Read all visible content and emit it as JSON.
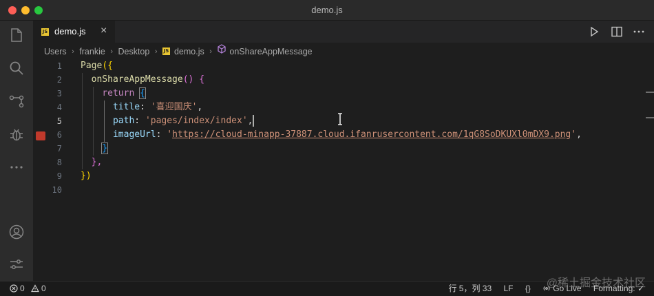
{
  "window": {
    "title": "demo.js"
  },
  "tab": {
    "badge": "JS",
    "label": "demo.js",
    "close": "×"
  },
  "breadcrumb": {
    "items": [
      "Users",
      "frankie",
      "Desktop",
      "demo.js",
      "onShareAppMessage"
    ],
    "separator": "›"
  },
  "editor": {
    "line_numbers": [
      "1",
      "2",
      "3",
      "4",
      "5",
      "6",
      "7",
      "8",
      "9",
      "10"
    ],
    "active_line": "5",
    "code": {
      "l1_fn": "Page",
      "l1_open": "({",
      "l2_fn": "onShareAppMessage",
      "l2_rest": "() {",
      "l3_kw": "return",
      "l3_brace": "{",
      "l4_prop": "title",
      "l4_colon": ": ",
      "l4_str": "'喜迎国庆'",
      "l4_comma": ",",
      "l5_prop": "path",
      "l5_colon": ": ",
      "l5_str": "'pages/index/index'",
      "l5_comma": ",",
      "l6_prop": "imageUrl",
      "l6_colon": ": ",
      "l6_q1": "'",
      "l6_url": "https://cloud-minapp-37887.cloud.ifanrusercontent.com/1qG8SoDKUXl0mDX9.png",
      "l6_q2": "'",
      "l6_comma": ",",
      "l7_brace": "}",
      "l8_close": "},",
      "l9_close": "})"
    }
  },
  "statusbar": {
    "errors": "0",
    "warnings": "0",
    "cursor_position": "行 5，列 33",
    "eol": "LF",
    "language_icon": "{}",
    "go_live": "Go Live",
    "formatting": "Formatting: ✓"
  },
  "watermark": "@稀土掘金技术社区",
  "icons": {
    "explorer": "files-icon",
    "search": "search-icon",
    "scm": "source-control-icon",
    "debug": "debug-icon",
    "more": "ellipsis-icon",
    "account": "account-icon",
    "settings": "settings-icon",
    "run": "play-icon",
    "split": "split-editor-icon",
    "more_actions": "ellipsis-icon"
  },
  "colors": {
    "function": "#dcdcaa",
    "keyword": "#c586c0",
    "property": "#9cdcfe",
    "string": "#ce9178",
    "bracket_1": "#ffd700",
    "bracket_2": "#da70d6",
    "bracket_3": "#179fff"
  }
}
